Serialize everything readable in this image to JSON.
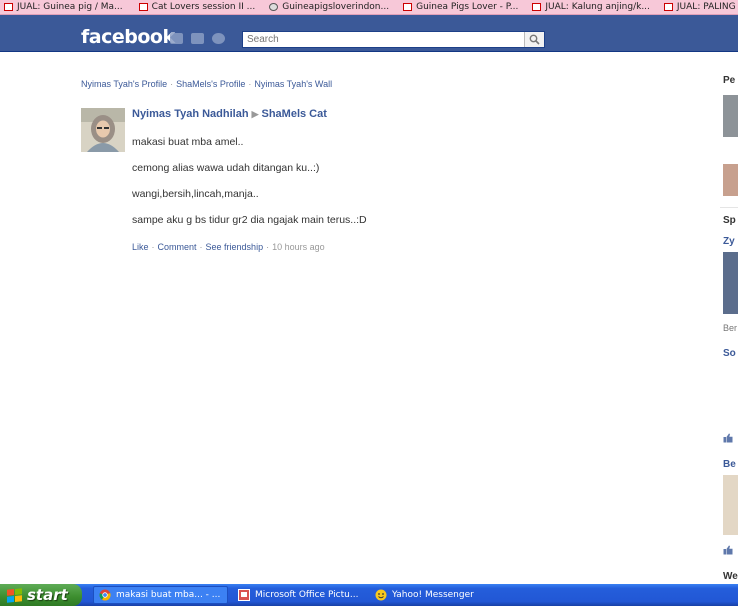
{
  "bookmarks": [
    {
      "label": "JUAL: Guinea pig / Ma...",
      "icon": "page-icon"
    },
    {
      "label": "Cat Lovers session II ...",
      "icon": "page-icon"
    },
    {
      "label": "Guineapigsloverindon...",
      "icon": "wordpress-icon"
    },
    {
      "label": "Guinea Pigs Lover - P...",
      "icon": "page-icon"
    },
    {
      "label": "JUAL: Kalung anjing/k...",
      "icon": "page-icon"
    },
    {
      "label": "JUAL: PALING M",
      "icon": "page-icon"
    }
  ],
  "header": {
    "logo": "facebook",
    "search_placeholder": "Search",
    "brand_color": "#3b5998"
  },
  "breadcrumb": [
    "Nyimas Tyah's Profile",
    "ShaMels's Profile",
    "Nyimas Tyah's Wall"
  ],
  "post": {
    "author": "Nyimas Tyah Nadhilah",
    "target": "ShaMels Cat",
    "lines": [
      "makasi buat mba amel..",
      "cemong alias wawa udah ditangan ku..:)",
      "wangi,bersih,lincah,manja..",
      "sampe aku g bs tidur gr2 dia ngajak main terus..:D"
    ],
    "actions": [
      "Like",
      "Comment",
      "See friendship"
    ],
    "time": "10 hours ago"
  },
  "right_column": {
    "headings": [
      "Pe",
      "Sp",
      "Zy",
      "So",
      "Be",
      "We"
    ],
    "text": "Ber"
  },
  "taskbar": {
    "start_label": "start",
    "tasks": [
      {
        "label": "makasi buat mba... - ...",
        "icon": "chrome-icon"
      },
      {
        "label": "Microsoft Office Pictu...",
        "icon": "picture-manager-icon"
      },
      {
        "label": "Yahoo! Messenger",
        "icon": "yahoo-messenger-icon"
      }
    ]
  }
}
